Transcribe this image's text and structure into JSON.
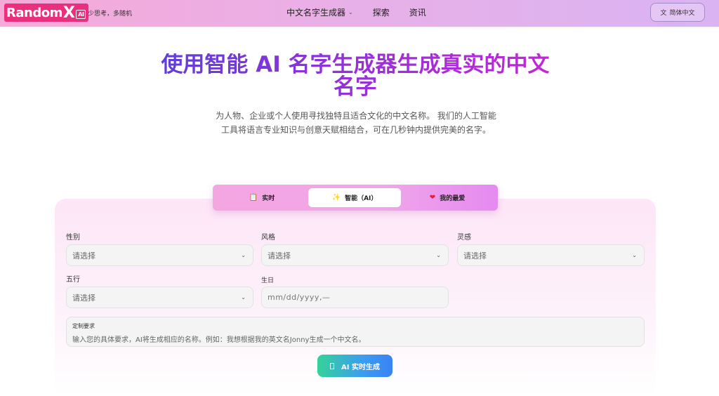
{
  "header": {
    "logo_text": "Random",
    "logo_x": "X",
    "logo_badge": "AI",
    "tagline": "少思考，多随机",
    "nav": [
      {
        "label": "中文名字生成器",
        "has_dropdown": true
      },
      {
        "label": "探索"
      },
      {
        "label": "资讯"
      }
    ],
    "language_button": "简体中文"
  },
  "hero": {
    "title_line1": "使用智能 AI 名字生成器生成真实的中文",
    "title_line2": "名字",
    "subtitle_line1": "为人物、企业或个人使用寻找独特且适合文化的中文名称。 我们的人工智能",
    "subtitle_line2": "工具将语言专业知识与创意天赋相结合，可在几秒钟内提供完美的名字。"
  },
  "tabs": [
    {
      "label": "实时",
      "icon": "clipboard-icon",
      "active": false
    },
    {
      "label": "智能（AI）",
      "icon": "sparkle-icon",
      "active": true
    },
    {
      "label": "我的最爱",
      "icon": "heart-icon",
      "active": false
    }
  ],
  "form": {
    "gender": {
      "label": "性别",
      "value": "请选择"
    },
    "style": {
      "label": "风格",
      "value": "请选择"
    },
    "inspiration": {
      "label": "灵感",
      "value": "请选择"
    },
    "five_elements": {
      "label": "五行",
      "value": "请选择"
    },
    "birthday": {
      "label": "生日",
      "placeholder": "mm/dd/yyyy,—"
    },
    "custom": {
      "label": "定制要求",
      "placeholder": "输入您的具体要求，AI将生成相应的名称。例如：我想根据我的英文名Jonny生成一个中文名。"
    },
    "generate_button": "AI 实时生成"
  },
  "colors": {
    "accent_pink": "#ea2f7e",
    "title_gradient_start": "#5b3fd8",
    "title_gradient_end": "#c527d6",
    "button_gradient_start": "#34d399",
    "button_gradient_end": "#3b82f6"
  }
}
